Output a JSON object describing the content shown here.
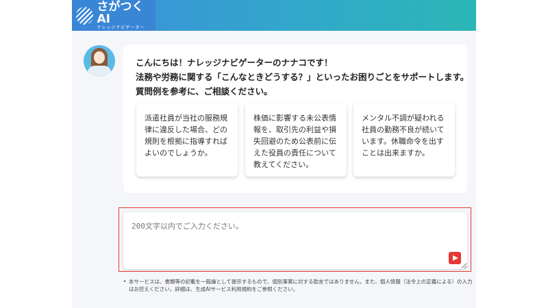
{
  "header": {
    "logo_title": "さがつくAI",
    "logo_subtitle": "ナレッジナビゲーター"
  },
  "greeting": {
    "lines": [
      "こんにちは！ナレッジナビゲーターのナナコです！",
      "法務や労務に関する「こんなときどうする？」といったお困りごとをサポートします。",
      "質問例を参考に、ご相談ください。"
    ]
  },
  "examples": [
    "派遣社員が当社の服務規律に違反した場合、どの規則を根拠に指導すればよいのでしょうか。",
    "株価に影響する未公表情報を、取引先の利益や損失回避のため公表前に伝えた役員の責任について教えてください。",
    "メンタル不調が疑われる社員の勤務不良が続いています。休職命令を出すことは出来ますか。"
  ],
  "input": {
    "placeholder": "200文字以内でご入力ください。",
    "value": ""
  },
  "disclaimer": "本サービスは、書類等の記載を一般論として提示するもので、個別事案に対する助言ではありません。また、個人情報（法令上の定義による）の入力はお控えください。詳細は、生成AIサービス利用規約をご参照ください。",
  "colors": {
    "accent": "#e53935",
    "header_start": "#3d8fdc",
    "header_end": "#2bb7b6"
  }
}
